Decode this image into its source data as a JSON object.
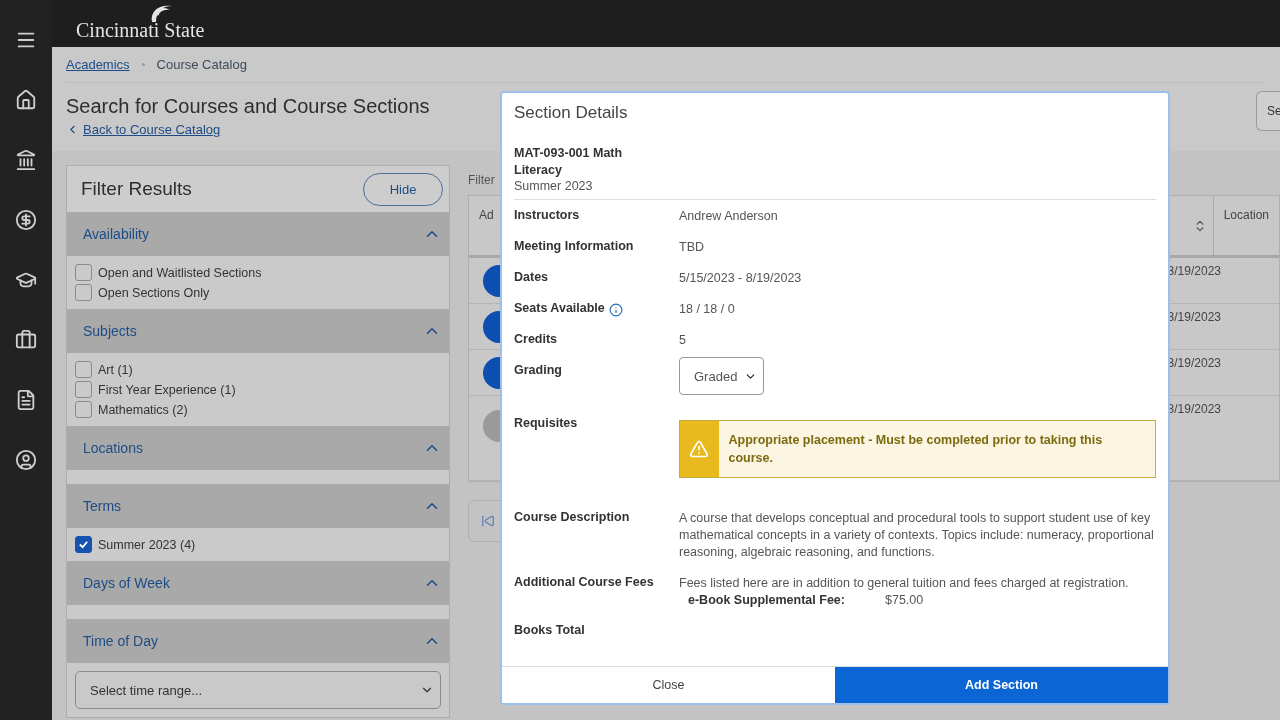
{
  "brand": {
    "name": "Cincinnati State"
  },
  "breadcrumbs": [
    {
      "label": "Academics",
      "link": true
    },
    {
      "label": "Course Catalog",
      "link": false
    }
  ],
  "page_title": "Search for Courses and Course Sections",
  "back_link": "Back to Course Catalog",
  "top_right_button": "Se",
  "filter_panel": {
    "title": "Filter Results",
    "hide_button": "Hide",
    "groups": [
      {
        "title": "Availability",
        "expanded": true,
        "options": [
          {
            "label": "Open and Waitlisted Sections",
            "checked": false
          },
          {
            "label": "Open Sections Only",
            "checked": false
          }
        ]
      },
      {
        "title": "Subjects",
        "expanded": true,
        "options": [
          {
            "label": "Art (1)",
            "checked": false
          },
          {
            "label": "First Year Experience (1)",
            "checked": false
          },
          {
            "label": "Mathematics (2)",
            "checked": false
          }
        ]
      },
      {
        "title": "Locations",
        "expanded": true
      },
      {
        "title": "Terms",
        "expanded": true,
        "options": [
          {
            "label": "Summer 2023 (4)",
            "checked": true
          }
        ]
      },
      {
        "title": "Days of Week",
        "expanded": true
      },
      {
        "title": "Time of Day",
        "expanded": true,
        "select": {
          "placeholder": "Select time range..."
        }
      }
    ]
  },
  "results": {
    "filters_label": "Filter",
    "columns": [
      {
        "label": "Ad"
      },
      {
        "label": "Location"
      }
    ],
    "rows": [
      {
        "date": "3/19/2023",
        "kind": "add"
      },
      {
        "date": "3/19/2023",
        "kind": "add"
      },
      {
        "date": "3/19/2023",
        "kind": "add"
      },
      {
        "date": "3/19/2023",
        "kind": "disabled"
      }
    ]
  },
  "modal": {
    "title": "Section Details",
    "course": "MAT-093-001 Math Literacy",
    "term": "Summer 2023",
    "fields": [
      {
        "label": "Instructors",
        "kind": "text",
        "value": "Andrew Anderson"
      },
      {
        "label": "Meeting Information",
        "kind": "text",
        "value": "TBD"
      },
      {
        "label": "Dates",
        "kind": "text",
        "value": "5/15/2023 - 8/19/2023"
      },
      {
        "label": "Seats Available",
        "kind": "text",
        "info": true,
        "value": "18 / 18 / 0"
      },
      {
        "label": "Credits",
        "kind": "text",
        "value": "5"
      },
      {
        "label": "Grading",
        "kind": "select",
        "value": "Graded"
      },
      {
        "label": "Requisites",
        "kind": "warning",
        "value": "Appropriate placement - Must be completed prior to taking this course."
      },
      {
        "label": "Course Description",
        "kind": "text",
        "value": "A course that develops conceptual and procedural tools to support student use of key mathematical concepts in a variety of contexts. Topics include: numeracy, proportional reasoning, algebraic reasoning, and functions."
      },
      {
        "label": "Additional Course Fees",
        "kind": "fees",
        "value": "Fees listed here are in addition to general tuition and fees charged at registration.",
        "fees": [
          {
            "name": "e-Book Supplemental Fee:",
            "amount": "$75.00"
          }
        ]
      },
      {
        "label": "Books Total",
        "kind": "empty"
      }
    ],
    "buttons": [
      {
        "label": "Close",
        "primary": false
      },
      {
        "label": "Add Section",
        "primary": true
      }
    ]
  }
}
